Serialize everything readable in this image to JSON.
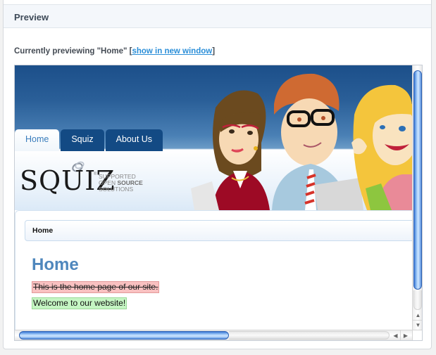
{
  "panel": {
    "title": "Preview",
    "preview_prefix": "Currently previewing \"Home\" [",
    "preview_link": "show in new window",
    "preview_suffix": "]"
  },
  "site": {
    "tabs": [
      {
        "label": "Home",
        "active": true
      },
      {
        "label": "Squiz",
        "active": false
      },
      {
        "label": "About Us",
        "active": false
      }
    ],
    "logo": {
      "word": "SQUIZ",
      "registered": "®",
      "tagline_1": "SUPPORTED",
      "tagline_2a": "OPEN ",
      "tagline_2b": "SOURCE",
      "tagline_3": "SOLUTIONS"
    },
    "header_illustration": "three-cartoon-office-workers",
    "breadcrumb": "Home",
    "page_heading": "Home",
    "deleted_text": "This is the home page of our site.",
    "inserted_text": "Welcome to our website!"
  },
  "scrollbars": {
    "up_arrow": "▲",
    "down_arrow": "▼",
    "left_arrow": "◀",
    "right_arrow": "▶"
  },
  "colors": {
    "link": "#2a8ed8",
    "heading": "#4f87bd",
    "tab_bg": "#134a84",
    "deleted_bg": "#f9c1c1",
    "inserted_bg": "#c5f5c3"
  }
}
